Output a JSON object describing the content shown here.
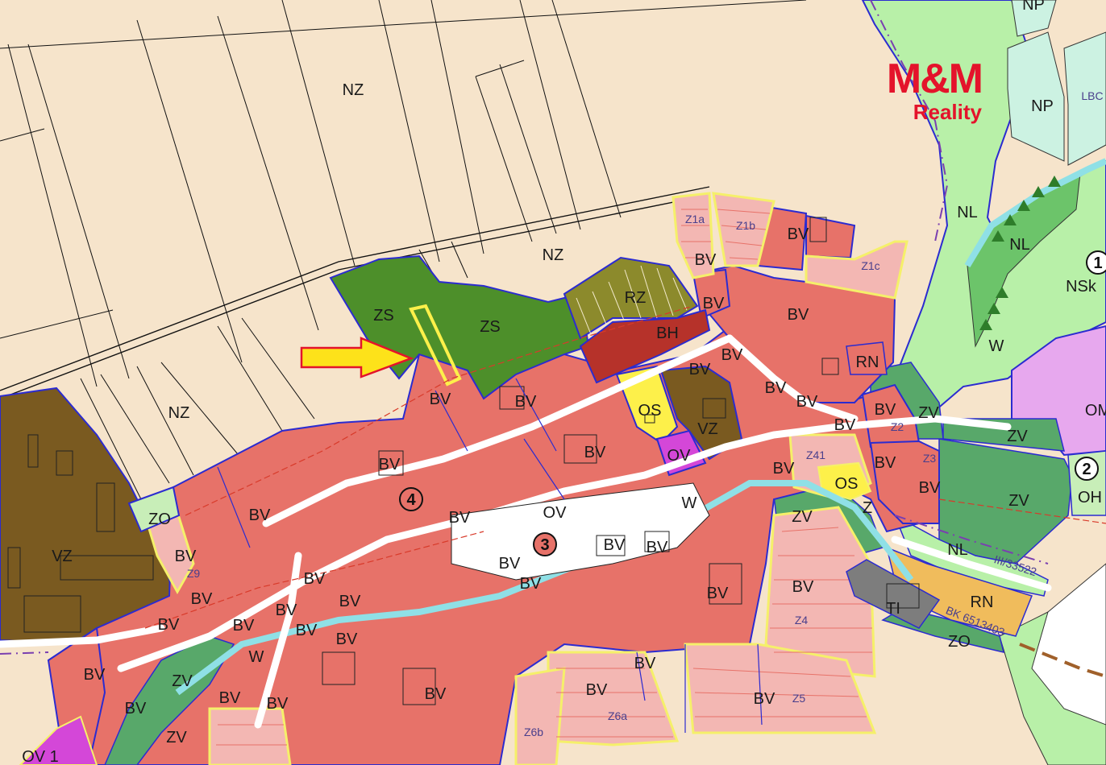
{
  "brand": {
    "main": "M&M",
    "sub": "Reality",
    "color": "#e4132b"
  },
  "colors": {
    "NZ": "#f6e4cb",
    "BV": "#e77269",
    "ZS": "#4d8f2a",
    "RZ": "#8c8a2c",
    "BH": "#b6322a",
    "OS": "#fdf04a",
    "OV": "#d447d8",
    "VZ": "#7a5a20",
    "ZV": "#58a86a",
    "NL": "#b8f0a8",
    "NP": "#ccf2e2",
    "RN": "#f0bc5c",
    "TI": "#7d7d7d",
    "W": "#8fe0e6",
    "ZO": "#c8eeb8",
    "OH": "#c8eeb8",
    "plot_border": "#2b2bd0",
    "proposed_border": "#f5f06a",
    "target_plot": "#fdf04a",
    "arrow": "#fde21a"
  },
  "zone_labels": {
    "nz1": "NZ",
    "nz2": "NZ",
    "nz3": "NZ",
    "zs1": "ZS",
    "zs2": "ZS",
    "rz": "RZ",
    "bh": "BH",
    "os1": "OS",
    "os2": "OS",
    "ov1": "OV",
    "ov2": "OV",
    "vz1": "VZ",
    "vz2": "VZ",
    "zo1": "ZO",
    "zo2": "ZO",
    "zv1": "ZV",
    "zv2": "ZV",
    "zv3": "ZV",
    "zv4": "ZV",
    "zv5": "ZV",
    "zv6": "ZV",
    "nl1": "NL",
    "nl2": "NL",
    "nl3": "NL",
    "np1": "NP",
    "np2": "NP",
    "lbc": "LBC",
    "nsk": "NSk",
    "rn1": "RN",
    "rn2": "RN",
    "ti": "TI",
    "oh": "OH",
    "om": "OM",
    "w1": "W",
    "w2": "W",
    "w3": "W",
    "z_small": "Z",
    "bv": [
      "BV",
      "BV",
      "BV",
      "BV",
      "BV",
      "BV",
      "BV",
      "BV",
      "BV",
      "BV",
      "BV",
      "BV",
      "BV",
      "BV",
      "BV",
      "BV",
      "BV",
      "BV",
      "BV",
      "BV",
      "BV",
      "BV",
      "BV",
      "BV",
      "BV",
      "BV",
      "BV",
      "BV",
      "BV",
      "BV",
      "BV",
      "BV",
      "BV",
      "BV",
      "BV",
      "BV",
      "BV",
      "BV",
      "BV",
      "BV",
      "BV",
      "BV"
    ]
  },
  "proposal_labels": {
    "z1a": "Z1a",
    "z1b": "Z1b",
    "z1c": "Z1c",
    "z2": "Z2",
    "z3": "Z3",
    "z4": "Z4",
    "z41": "Z41",
    "z5": "Z5",
    "z6a": "Z6a",
    "z6b": "Z6b",
    "z9": "Z9"
  },
  "road_labels": {
    "road_iii": "III/33522",
    "road_bk": "BK 6513403"
  },
  "circle_markers": [
    "1",
    "2",
    "3",
    "4"
  ],
  "partial_labels": {
    "ov1_edge": "OV 1"
  }
}
